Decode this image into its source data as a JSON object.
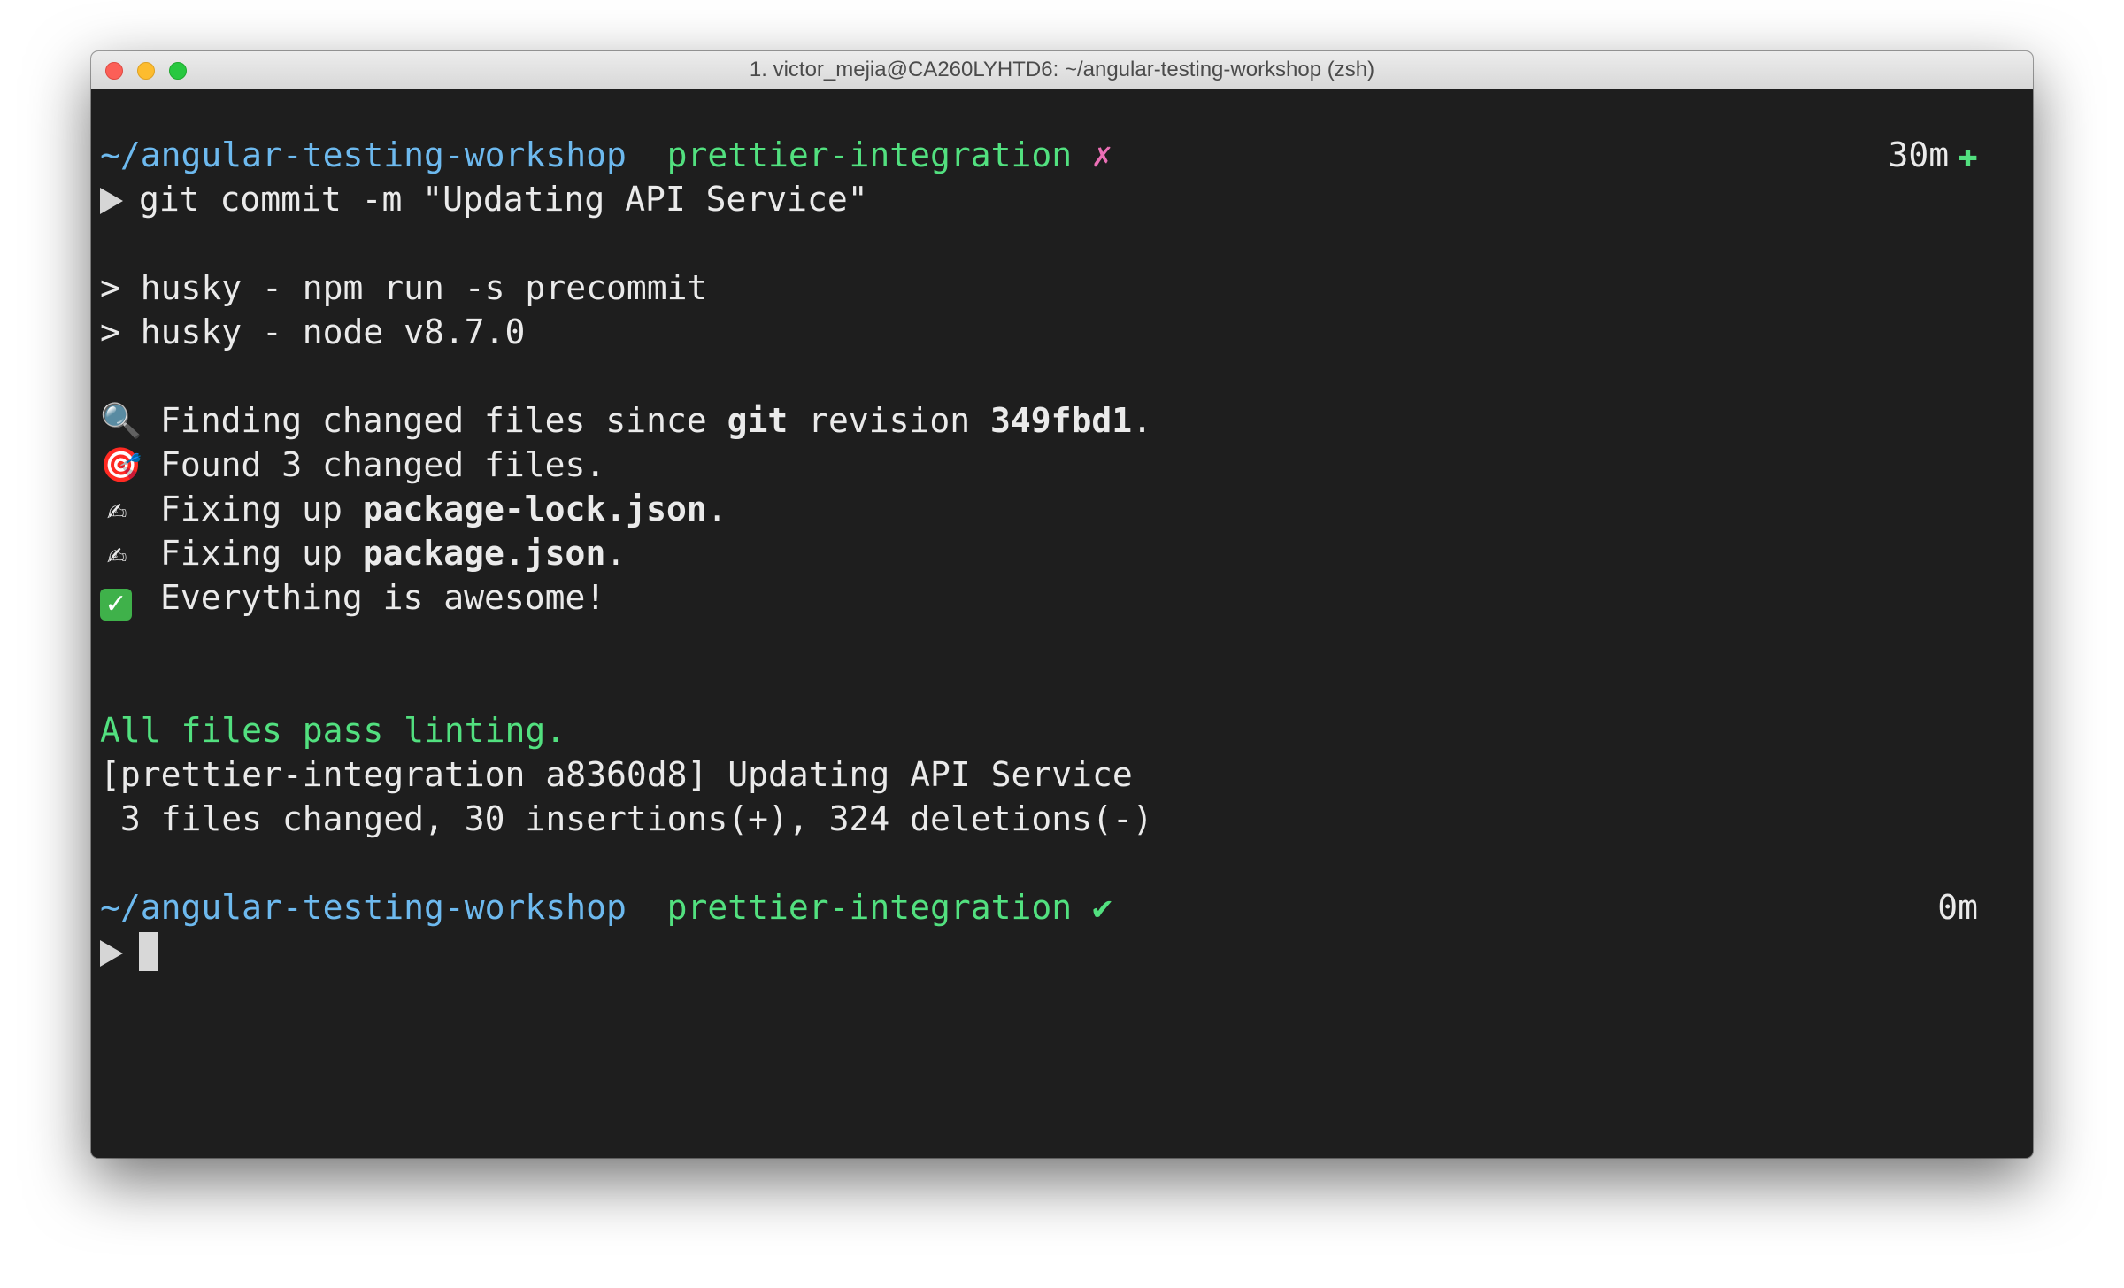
{
  "window": {
    "title": "1. victor_mejia@CA260LYHTD6: ~/angular-testing-workshop (zsh)"
  },
  "prompt1": {
    "path": "~/angular-testing-workshop",
    "branch": "prettier-integration",
    "status": "✗",
    "elapsed": "30m",
    "plus": "✚"
  },
  "command": "git commit -m \"Updating API Service\"",
  "husky": {
    "line1": "> husky - npm run -s precommit",
    "line2": "> husky - node v8.7.0"
  },
  "pretty_quick": {
    "finding_prefix": "Finding changed files since ",
    "finding_git": "git",
    "finding_mid": " revision ",
    "finding_rev": "349fbd1",
    "finding_end": ".",
    "found": "Found 3 changed files.",
    "fixing_prefix": "Fixing up ",
    "file1": "package-lock.json",
    "file2": "package.json",
    "dot": ".",
    "awesome": "Everything is awesome!"
  },
  "lint": "All files pass linting.",
  "commit_summary": "[prettier-integration a8360d8] Updating API Service",
  "changes": " 3 files changed, 30 insertions(+), 324 deletions(-)",
  "prompt2": {
    "path": "~/angular-testing-workshop",
    "branch": "prettier-integration",
    "status": "✔",
    "elapsed": "0m"
  },
  "icons": {
    "search": "🔍",
    "target": "🎯",
    "writing": "✍",
    "check": "✓"
  },
  "colors": {
    "background": "#1e1e1e",
    "path": "#6db9ee",
    "branch": "#52e07f",
    "dirty": "#ec6fb6"
  }
}
